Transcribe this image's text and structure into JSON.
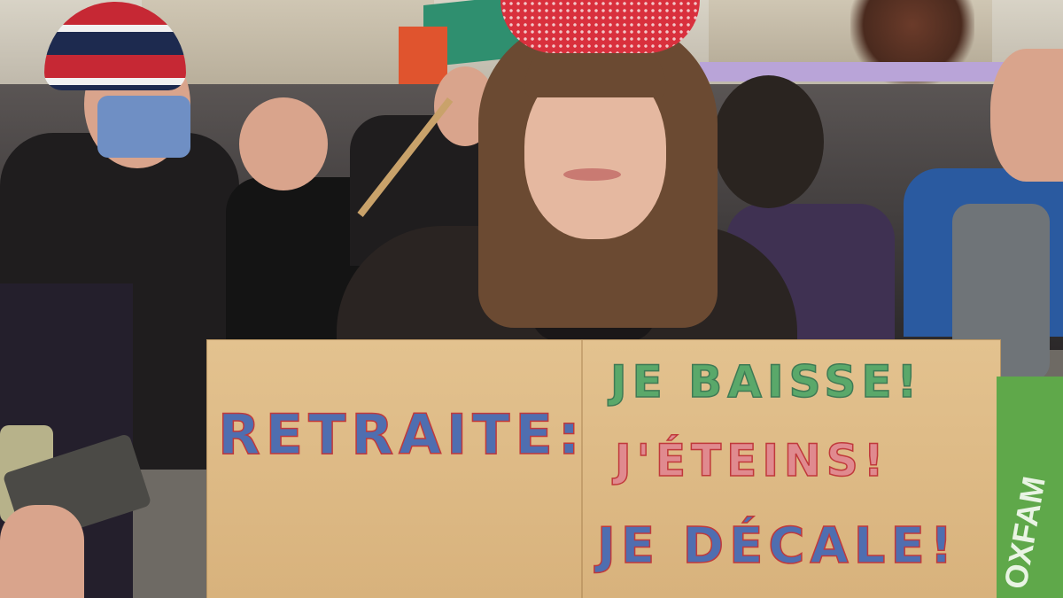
{
  "sign": {
    "left": "RETRAITE:",
    "line1": "JE BAISSE!",
    "line2": "J'ÉTEINS!",
    "line3": "JE DÉCALE!"
  },
  "banner": {
    "text": "OXFAM"
  },
  "colors": {
    "cardboard": "#dbb680",
    "blue_ink": "#4f6eb0",
    "green_ink": "#5aa86a",
    "red_outline": "#c0393b",
    "hat_red": "#d9303d",
    "banner_green": "#5fa84a"
  }
}
